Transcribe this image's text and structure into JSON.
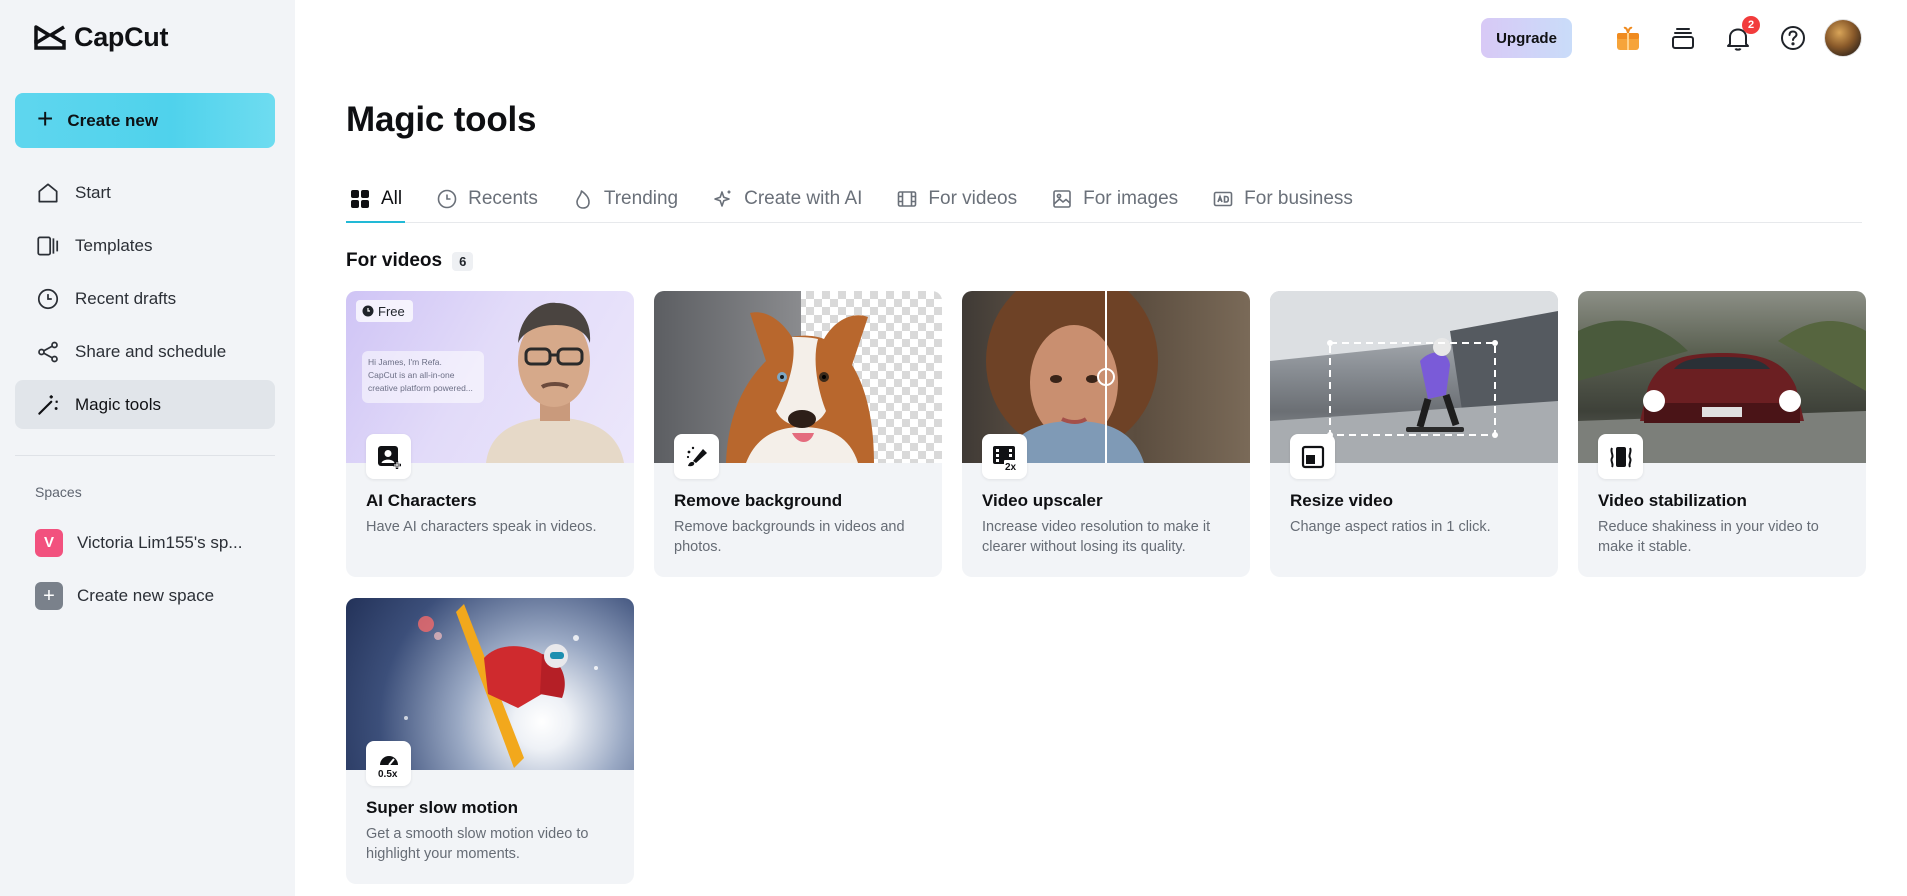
{
  "app": {
    "name": "CapCut"
  },
  "sidebar": {
    "create_label": "Create new",
    "items": [
      {
        "label": "Start",
        "icon": "home-icon"
      },
      {
        "label": "Templates",
        "icon": "templates-icon"
      },
      {
        "label": "Recent drafts",
        "icon": "clock-icon"
      },
      {
        "label": "Share and schedule",
        "icon": "share-icon"
      },
      {
        "label": "Magic tools",
        "icon": "magic-wand-icon",
        "active": true
      }
    ],
    "spaces_label": "Spaces",
    "space_name": "Victoria Lim155's sp...",
    "space_initial": "V",
    "create_space_label": "Create new space"
  },
  "topbar": {
    "upgrade_label": "Upgrade",
    "notification_count": "2"
  },
  "main": {
    "title": "Magic tools",
    "tabs": [
      {
        "label": "All",
        "icon": "grid-icon",
        "active": true
      },
      {
        "label": "Recents",
        "icon": "clock-icon"
      },
      {
        "label": "Trending",
        "icon": "flame-icon"
      },
      {
        "label": "Create with AI",
        "icon": "sparkle-icon"
      },
      {
        "label": "For videos",
        "icon": "film-icon"
      },
      {
        "label": "For images",
        "icon": "image-icon"
      },
      {
        "label": "For business",
        "icon": "ad-icon"
      }
    ],
    "section_title": "For videos",
    "section_count": "6",
    "cards": [
      {
        "name": "AI Characters",
        "desc": "Have AI characters speak in videos.",
        "tag": "Free",
        "thumb_text": [
          "Hi James, I'm Refa.",
          "CapCut is an all-in-one",
          "creative platform powered..."
        ]
      },
      {
        "name": "Remove background",
        "desc": "Remove backgrounds in videos and photos."
      },
      {
        "name": "Video upscaler",
        "desc": "Increase video resolution to make it clearer without losing its quality.",
        "icon_text": "2x"
      },
      {
        "name": "Resize video",
        "desc": "Change aspect ratios in 1 click."
      },
      {
        "name": "Video stabilization",
        "desc": "Reduce shakiness in your video to make it stable."
      },
      {
        "name": "Super slow motion",
        "desc": "Get a smooth slow motion video to highlight your moments.",
        "icon_text": "0.5x"
      }
    ]
  },
  "colors": {
    "accent": "#22b9d6",
    "sidebar_bg": "#f2f4f7",
    "badge": "#f23c3c",
    "space_avatar": "#f2517e"
  }
}
